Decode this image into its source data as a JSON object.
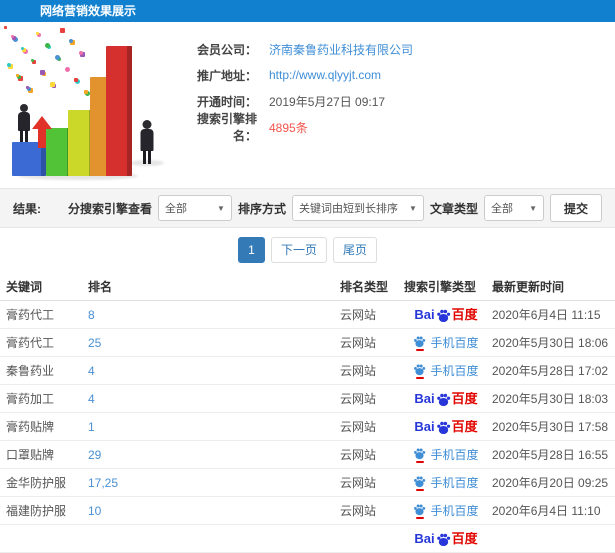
{
  "colors": {
    "header_bg": "#1181cf",
    "link_blue": "#3f8ed6",
    "highlight_red": "#f4544c",
    "baidu_blue": "#2636d9",
    "baidu_red": "#e10601",
    "mobile_blue": "#3f8ed6",
    "rank_blue": "#4a90d2",
    "pagination_blue": "#337ab7"
  },
  "header": {
    "title": "网络营销效果展示"
  },
  "info": {
    "rows": [
      {
        "label": "会员公司：",
        "value": "济南秦鲁药业科技有限公司",
        "style": "link"
      },
      {
        "label": "推广地址：",
        "value": "http://www.qlyyjt.com",
        "style": "link"
      },
      {
        "label": "开通时间：",
        "value": "2019年5月27日 09:17",
        "style": "plain"
      },
      {
        "label": "搜索引擎排名：",
        "value": "4895条",
        "style": "highlight"
      }
    ]
  },
  "filters": {
    "result_label": "结果:",
    "engine_label": "分搜索引擎查看",
    "engine_value": "全部",
    "sort_label": "排序方式",
    "sort_value": "关键词由短到长排序",
    "article_label": "文章类型",
    "article_value": "全部",
    "submit_label": "提交",
    "caret": "▼"
  },
  "pagination": {
    "buttons": [
      {
        "label": "1",
        "active": true
      },
      {
        "label": "下一页",
        "active": false
      },
      {
        "label": "尾页",
        "active": false
      }
    ]
  },
  "table": {
    "headers": [
      "关键词",
      "排名",
      "排名类型",
      "搜索引擎类型",
      "最新更新时间"
    ],
    "engine_labels": {
      "baidu_prefix": "Bai",
      "baidu_suffix": "百度",
      "mobile": "手机百度"
    },
    "rows": [
      {
        "keyword": "膏药代工",
        "rank": "8",
        "rank_type": "云网站",
        "engine": "baidu",
        "time": "2020年6月4日 11:15"
      },
      {
        "keyword": "膏药代工",
        "rank": "25",
        "rank_type": "云网站",
        "engine": "mobile",
        "time": "2020年5月30日 18:06"
      },
      {
        "keyword": "秦鲁药业",
        "rank": "4",
        "rank_type": "云网站",
        "engine": "mobile",
        "time": "2020年5月28日 17:02"
      },
      {
        "keyword": "膏药加工",
        "rank": "4",
        "rank_type": "云网站",
        "engine": "baidu",
        "time": "2020年5月30日 18:03"
      },
      {
        "keyword": "膏药贴牌",
        "rank": "1",
        "rank_type": "云网站",
        "engine": "baidu",
        "time": "2020年5月30日 17:58"
      },
      {
        "keyword": "口罩贴牌",
        "rank": "29",
        "rank_type": "云网站",
        "engine": "mobile",
        "time": "2020年5月28日 16:55"
      },
      {
        "keyword": "金华防护服",
        "rank": "17,25",
        "rank_type": "云网站",
        "engine": "mobile",
        "time": "2020年6月20日 09:25"
      },
      {
        "keyword": "福建防护服",
        "rank": "10",
        "rank_type": "云网站",
        "engine": "mobile",
        "time": "2020年6月4日 11:10"
      },
      {
        "keyword": "",
        "rank": "",
        "rank_type": "",
        "engine": "baidu",
        "time": ""
      }
    ]
  },
  "illustration": {
    "bar_colors": [
      "#3b6ad4",
      "#52c236",
      "#ccd829",
      "#e2932d",
      "#d52f2e"
    ],
    "confetti_colors": [
      "#e8413c",
      "#3bb54a",
      "#f5a623",
      "#4a90d2",
      "#9b59b6",
      "#f06eaa",
      "#ffd93b",
      "#32c8c8"
    ]
  }
}
